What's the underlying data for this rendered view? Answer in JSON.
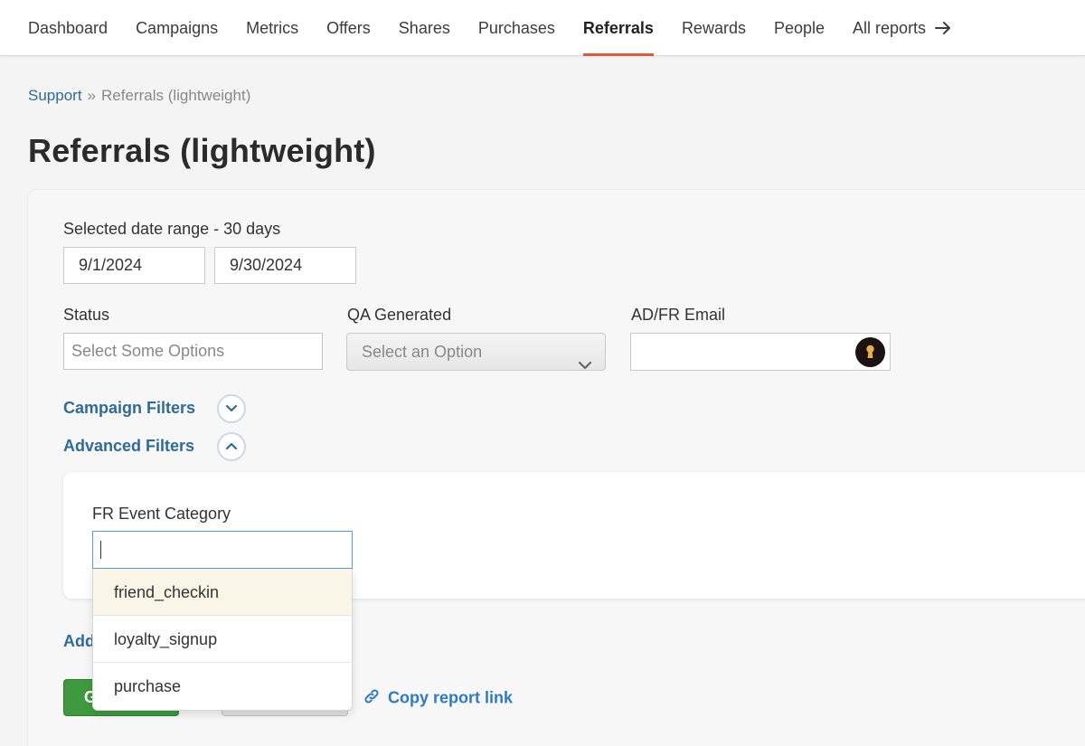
{
  "nav": {
    "items": [
      {
        "label": "Dashboard"
      },
      {
        "label": "Campaigns"
      },
      {
        "label": "Metrics"
      },
      {
        "label": "Offers"
      },
      {
        "label": "Shares"
      },
      {
        "label": "Purchases"
      },
      {
        "label": "Referrals",
        "active": true
      },
      {
        "label": "Rewards"
      },
      {
        "label": "People"
      },
      {
        "label": "All reports"
      }
    ],
    "accent_color": "#e8553b"
  },
  "breadcrumb": {
    "root": "Support",
    "separator": "»",
    "current": "Referrals (lightweight)"
  },
  "page": {
    "title": "Referrals (lightweight)"
  },
  "filters": {
    "date_range_label": "Selected date range - 30 days",
    "start_date": "9/1/2024",
    "end_date": "9/30/2024",
    "status_label": "Status",
    "status_placeholder": "Select Some Options",
    "qa_label": "QA Generated",
    "qa_placeholder": "Select an Option",
    "email_label": "AD/FR Email",
    "email_value": "",
    "campaign_filters_label": "Campaign Filters",
    "advanced_filters_label": "Advanced Filters"
  },
  "advanced": {
    "fr_event_category_label": "FR Event Category",
    "fr_event_category_value": "",
    "options": [
      "friend_checkin",
      "loyalty_signup",
      "purchase"
    ],
    "highlighted_option": "friend_checkin"
  },
  "actions": {
    "add_link_partial": "Add",
    "generate_partial": "G",
    "copy_report_link": "Copy report link"
  },
  "colors": {
    "link": "#2e6a9b",
    "primary_button": "#3f9a3f",
    "highlight_row": "#faf6e7"
  }
}
